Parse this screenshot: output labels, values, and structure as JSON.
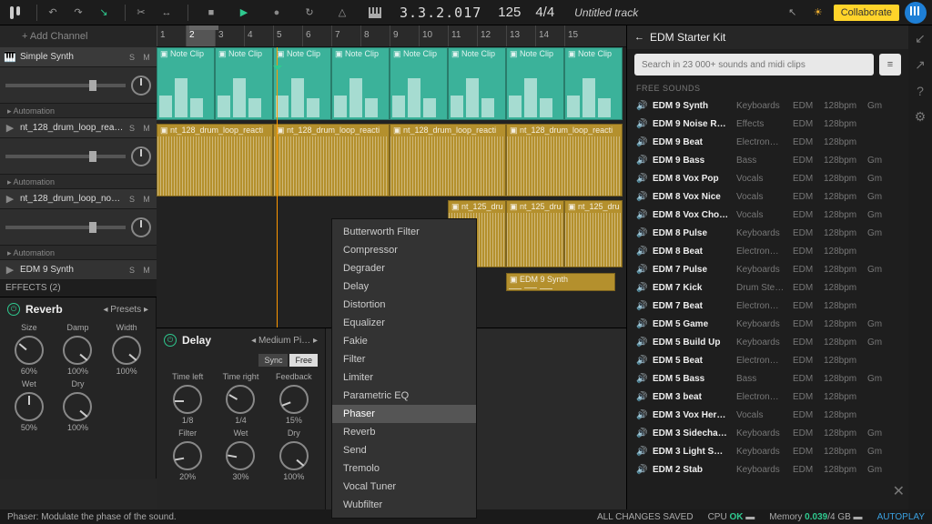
{
  "topbar": {
    "timecode": "3.3.2.017",
    "tempo": "125",
    "timesig": "4/4",
    "title": "Untitled track",
    "collab": "Collaborate"
  },
  "left": {
    "add": "+ Add Channel",
    "tracks": [
      {
        "name": "Simple Synth",
        "automation": "Automation"
      },
      {
        "name": "nt_128_drum_loop_reacti…",
        "automation": "Automation"
      },
      {
        "name": "nt_128_drum_loop_nowhe…",
        "automation": "Automation"
      },
      {
        "name": "EDM 9 Synth",
        "automation": ""
      }
    ]
  },
  "ruler": [
    "1",
    "2",
    "3",
    "4",
    "5",
    "6",
    "7",
    "8",
    "9",
    "10",
    "11",
    "12",
    "13",
    "14",
    "15"
  ],
  "clips": {
    "note": "Note Clip",
    "drum": "nt_128_drum_loop_reacti",
    "drum2": "nt_125_dru",
    "synth": "EDM 9 Synth"
  },
  "fx": {
    "header": "EFFECTS (2)",
    "reverb": {
      "name": "Reverb",
      "preset": "Presets",
      "knobs": [
        {
          "lbl": "Size",
          "val": "60%",
          "r": "-50deg"
        },
        {
          "lbl": "Damp",
          "val": "100%",
          "r": "130deg"
        },
        {
          "lbl": "Width",
          "val": "100%",
          "r": "130deg"
        },
        {
          "lbl": "Wet",
          "val": "50%",
          "r": "0deg"
        },
        {
          "lbl": "Dry",
          "val": "100%",
          "r": "130deg"
        }
      ]
    },
    "delay": {
      "name": "Delay",
      "preset": "Medium Pi…",
      "sync": "Sync",
      "free": "Free",
      "knobs": [
        {
          "lbl": "Time left",
          "val": "1/8",
          "r": "-90deg"
        },
        {
          "lbl": "Time right",
          "val": "1/4",
          "r": "-60deg"
        },
        {
          "lbl": "Feedback",
          "val": "15%",
          "r": "-110deg"
        },
        {
          "lbl": "Filter",
          "val": "20%",
          "r": "-100deg"
        },
        {
          "lbl": "Wet",
          "val": "30%",
          "r": "-80deg"
        },
        {
          "lbl": "Dry",
          "val": "100%",
          "r": "130deg"
        }
      ]
    }
  },
  "ctx": [
    "Butterworth Filter",
    "Compressor",
    "Degrader",
    "Delay",
    "Distortion",
    "Equalizer",
    "Fakie",
    "Filter",
    "Limiter",
    "Parametric EQ",
    "Phaser",
    "Reverb",
    "Send",
    "Tremolo",
    "Vocal Tuner",
    "Wubfilter"
  ],
  "ctx_hover_index": 10,
  "right": {
    "title": "EDM Starter Kit",
    "placeholder": "Search in 23 000+ sounds and midi clips",
    "cat": "FREE SOUNDS",
    "sounds": [
      {
        "n": "EDM 9 Synth",
        "t": "Keyboards",
        "g": "EDM",
        "b": "128bpm",
        "k": "Gm"
      },
      {
        "n": "EDM 9 Noise R…",
        "t": "Effects",
        "g": "EDM",
        "b": "128bpm",
        "k": ""
      },
      {
        "n": "EDM 9 Beat",
        "t": "Electron…",
        "g": "EDM",
        "b": "128bpm",
        "k": ""
      },
      {
        "n": "EDM 9 Bass",
        "t": "Bass",
        "g": "EDM",
        "b": "128bpm",
        "k": "Gm"
      },
      {
        "n": "EDM 8 Vox Pop",
        "t": "Vocals",
        "g": "EDM",
        "b": "128bpm",
        "k": "Gm"
      },
      {
        "n": "EDM 8 Vox Nice",
        "t": "Vocals",
        "g": "EDM",
        "b": "128bpm",
        "k": "Gm"
      },
      {
        "n": "EDM 8 Vox Cho…",
        "t": "Vocals",
        "g": "EDM",
        "b": "128bpm",
        "k": "Gm"
      },
      {
        "n": "EDM 8 Pulse",
        "t": "Keyboards",
        "g": "EDM",
        "b": "128bpm",
        "k": "Gm"
      },
      {
        "n": "EDM 8 Beat",
        "t": "Electron…",
        "g": "EDM",
        "b": "128bpm",
        "k": ""
      },
      {
        "n": "EDM 7 Pulse",
        "t": "Keyboards",
        "g": "EDM",
        "b": "128bpm",
        "k": "Gm"
      },
      {
        "n": "EDM 7 Kick",
        "t": "Drum Ste…",
        "g": "EDM",
        "b": "128bpm",
        "k": ""
      },
      {
        "n": "EDM 7 Beat",
        "t": "Electron…",
        "g": "EDM",
        "b": "128bpm",
        "k": ""
      },
      {
        "n": "EDM 5 Game",
        "t": "Keyboards",
        "g": "EDM",
        "b": "128bpm",
        "k": "Gm"
      },
      {
        "n": "EDM 5 Build Up",
        "t": "Keyboards",
        "g": "EDM",
        "b": "128bpm",
        "k": "Gm"
      },
      {
        "n": "EDM 5 Beat",
        "t": "Electron…",
        "g": "EDM",
        "b": "128bpm",
        "k": ""
      },
      {
        "n": "EDM 5 Bass",
        "t": "Bass",
        "g": "EDM",
        "b": "128bpm",
        "k": "Gm"
      },
      {
        "n": "EDM 3 beat",
        "t": "Electron…",
        "g": "EDM",
        "b": "128bpm",
        "k": ""
      },
      {
        "n": "EDM 3 Vox Her…",
        "t": "Vocals",
        "g": "EDM",
        "b": "128bpm",
        "k": ""
      },
      {
        "n": "EDM 3 Sidecha…",
        "t": "Keyboards",
        "g": "EDM",
        "b": "128bpm",
        "k": "Gm"
      },
      {
        "n": "EDM 3 Light S…",
        "t": "Keyboards",
        "g": "EDM",
        "b": "128bpm",
        "k": "Gm"
      },
      {
        "n": "EDM 2 Stab",
        "t": "Keyboards",
        "g": "EDM",
        "b": "128bpm",
        "k": "Gm"
      }
    ]
  },
  "footer": {
    "hint": "Phaser:  Modulate the phase of the sound.",
    "saved": "ALL CHANGES SAVED",
    "cpu_l": "CPU",
    "cpu_v": "OK",
    "mem_l": "Memory",
    "mem_v": "0.039",
    "mem_t": "/4 GB",
    "autoplay": "AUTOPLAY"
  }
}
